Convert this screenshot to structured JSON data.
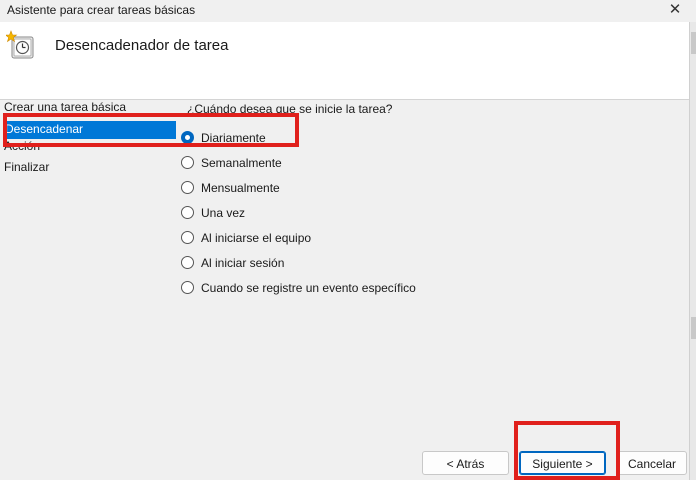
{
  "window": {
    "title": "Asistente para crear tareas básicas",
    "close_glyph": "✕"
  },
  "header": {
    "title": "Desencadenador de tarea",
    "icon": "task-scheduler-clock-icon"
  },
  "steps": [
    {
      "label": "Crear una tarea básica",
      "active": false
    },
    {
      "label": "Desencadenar",
      "active": true
    },
    {
      "label": "Acción",
      "active": false
    },
    {
      "label": "Finalizar",
      "active": false
    }
  ],
  "question": "¿Cuándo desea que se inicie la tarea?",
  "options": [
    {
      "label": "Diariamente",
      "checked": true
    },
    {
      "label": "Semanalmente",
      "checked": false
    },
    {
      "label": "Mensualmente",
      "checked": false
    },
    {
      "label": "Una vez",
      "checked": false
    },
    {
      "label": "Al iniciarse el equipo",
      "checked": false
    },
    {
      "label": "Al iniciar sesión",
      "checked": false
    },
    {
      "label": "Cuando se registre un evento específico",
      "checked": false
    }
  ],
  "buttons": {
    "back": "< Atrás",
    "next": "Siguiente >",
    "cancel": "Cancelar"
  },
  "colors": {
    "accent": "#0078d7",
    "highlight": "#e0201c"
  }
}
